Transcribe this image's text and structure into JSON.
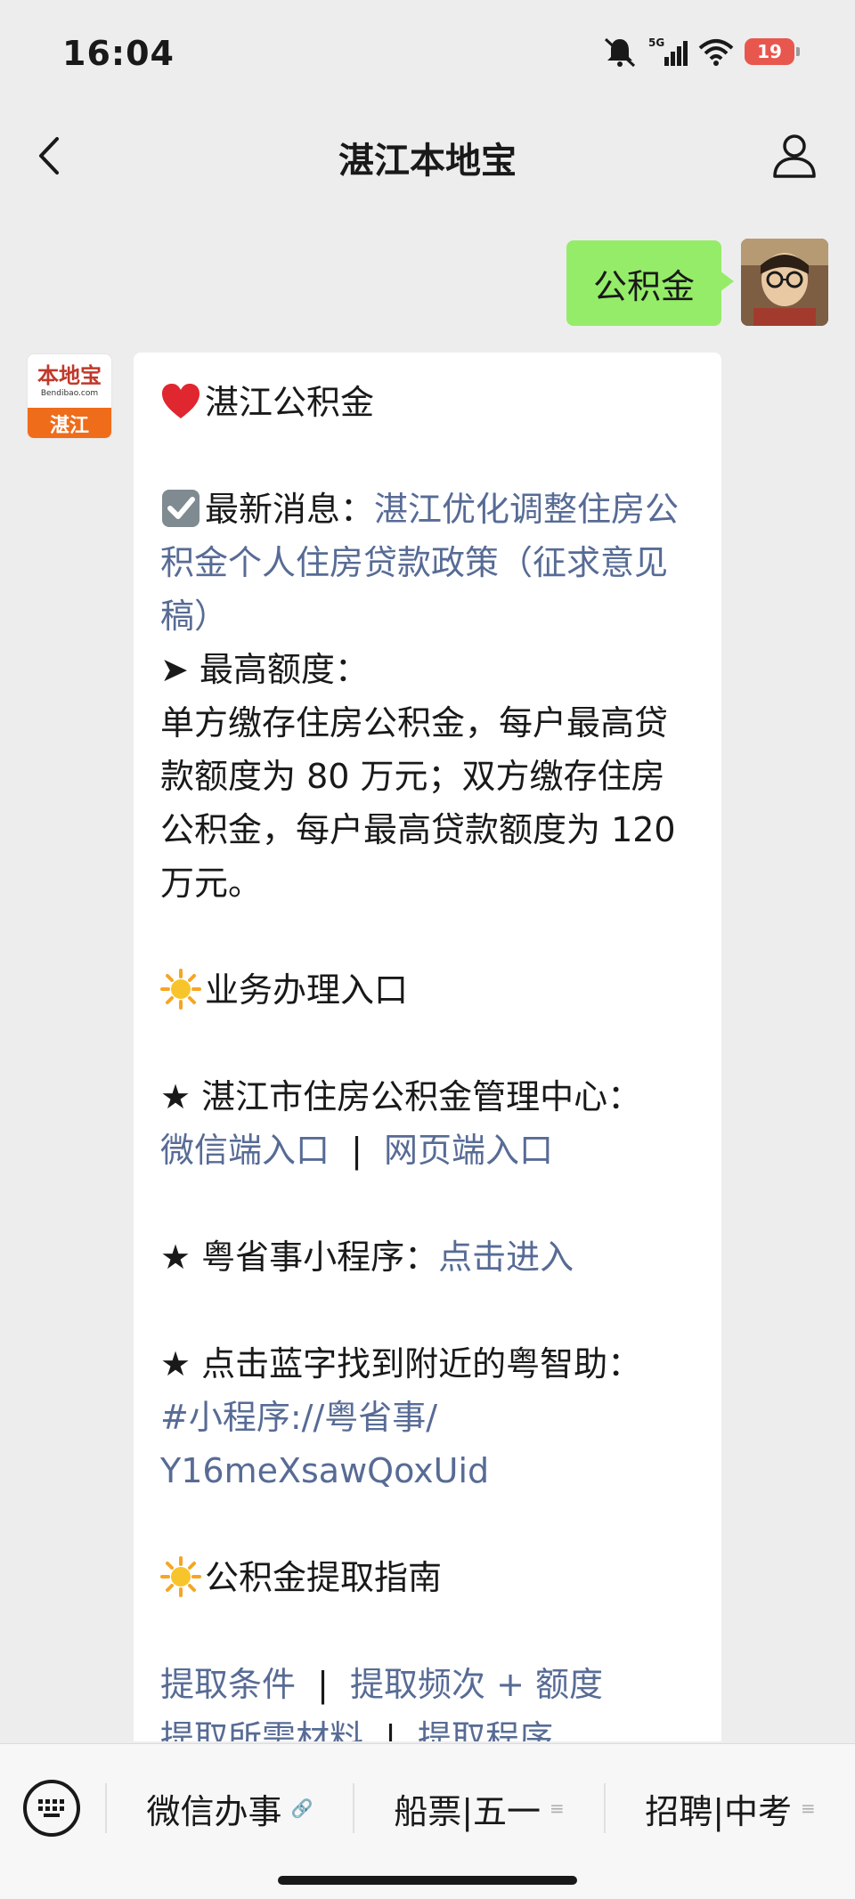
{
  "status_bar": {
    "time": "16:04",
    "network": "5G",
    "battery": "19"
  },
  "header": {
    "title": "湛江本地宝"
  },
  "chat": {
    "outgoing_text": "公积金",
    "bot_avatar": {
      "brand": "本地宝",
      "domain": "Bendibao.com",
      "city": "湛江"
    },
    "card": {
      "title": "湛江公积金",
      "latest_label": "最新消息：",
      "latest_link": "湛江优化调整住房公积金个人住房贷款政策（征求意见稿）",
      "limit_heading": "➤ 最高额度：",
      "limit_text": "单方缴存住房公积金，每户最高贷款额度为 80 万元；双方缴存住房公积金，每户最高贷款额度为 120 万元。",
      "section1_title": "业务办理入口",
      "center_label": "★ 湛江市住房公积金管理中心：",
      "center_link1": "微信端入口",
      "center_sep": "|",
      "center_link2": "网页端入口",
      "yue_label": "★ 粤省事小程序：",
      "yue_link": "点击进入",
      "nearby_label": "★ 点击蓝字找到附近的粤智助：",
      "nearby_link_line1": "#小程序://粤省事/",
      "nearby_link_line2": "Y16meXsawQoxUid",
      "section2_title": "公积金提取指南",
      "guide_link1": "提取条件",
      "guide_link2": "提取频次 + 额度",
      "guide_link3": "提取所需材料",
      "guide_link4": "提取程序",
      "guide_sep": "|"
    }
  },
  "bottom_menu": {
    "items": [
      {
        "label": "微信办事",
        "suffix": "🔗"
      },
      {
        "label": "船票|五一",
        "suffix": "≡"
      },
      {
        "label": "招聘|中考",
        "suffix": "≡"
      }
    ]
  },
  "colors": {
    "link": "#576b95",
    "outgoing_bubble": "#95ec69",
    "background": "#ededed"
  },
  "icons": [
    "back-icon",
    "profile-icon",
    "keyboard-icon",
    "heart-emoji",
    "checkbox-emoji",
    "sun-emoji",
    "link-icon",
    "menu-icon"
  ]
}
